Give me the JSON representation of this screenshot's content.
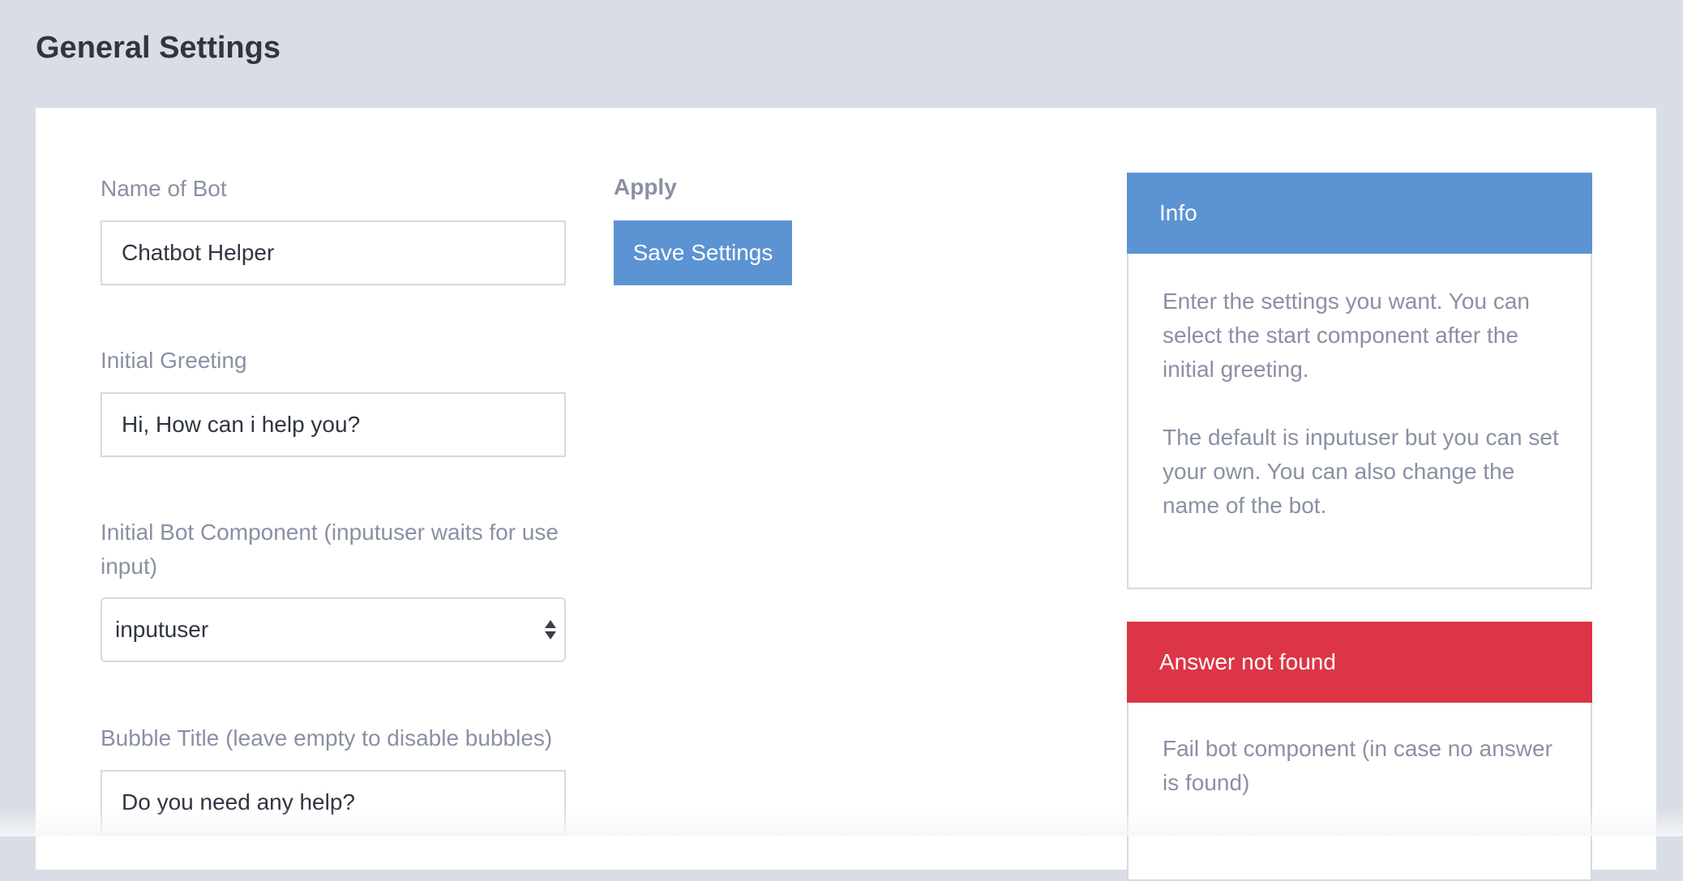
{
  "page": {
    "title": "General Settings"
  },
  "form": {
    "bot_name": {
      "label": "Name of Bot",
      "value": "Chatbot Helper"
    },
    "initial_greeting": {
      "label": "Initial Greeting",
      "value": "Hi, How can i help you?"
    },
    "initial_component": {
      "label": "Initial Bot Component (inputuser waits for use input)",
      "selected": "inputuser"
    },
    "bubble_title": {
      "label": "Bubble Title (leave empty to disable bubbles)",
      "value": "Do you need any help?"
    }
  },
  "apply": {
    "label": "Apply",
    "button": "Save Settings"
  },
  "info_panel": {
    "title": "Info",
    "color": "#5b93d3",
    "paragraphs": [
      "Enter the settings you want. You can select the start component after the initial greeting.",
      "The default is inputuser but you can set your own. You can also change the name of the bot."
    ]
  },
  "answer_panel": {
    "title": "Answer not found",
    "color": "#dc3545",
    "text": "Fail bot component (in case no answer is found)"
  }
}
